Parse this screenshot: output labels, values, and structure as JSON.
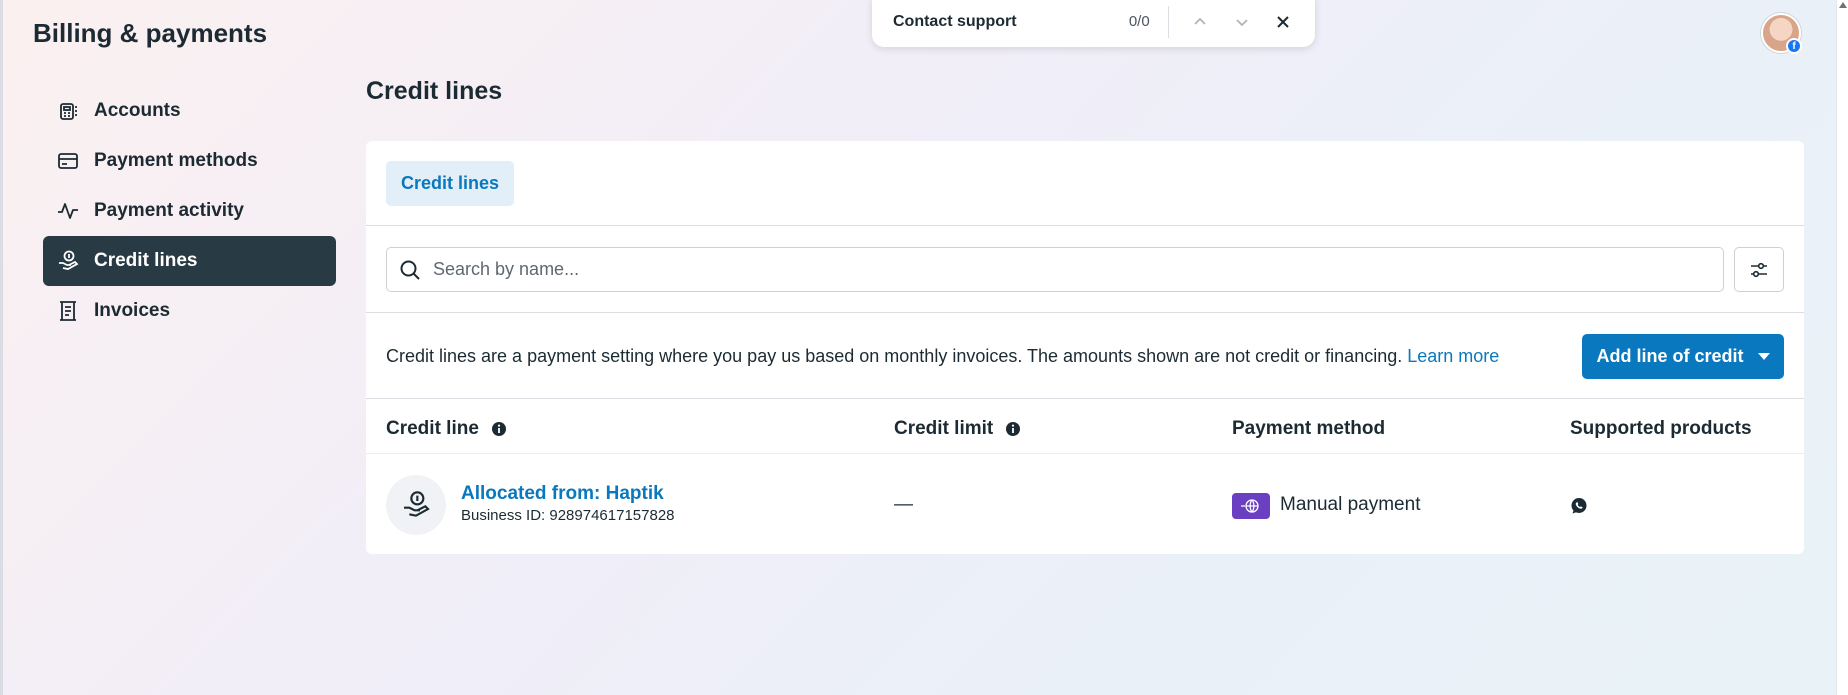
{
  "app": {
    "title": "Billing & payments"
  },
  "sidebar": {
    "items": [
      {
        "label": "Accounts",
        "icon": "accounts-icon",
        "active": false
      },
      {
        "label": "Payment methods",
        "icon": "card-icon",
        "active": false
      },
      {
        "label": "Payment activity",
        "icon": "activity-icon",
        "active": false
      },
      {
        "label": "Credit lines",
        "icon": "credit-line-icon",
        "active": true
      },
      {
        "label": "Invoices",
        "icon": "invoice-icon",
        "active": false
      }
    ]
  },
  "support_popup": {
    "label": "Contact support",
    "count": "0/0"
  },
  "page": {
    "title": "Credit lines",
    "tab": "Credit lines",
    "search_placeholder": "Search by name...",
    "info_text": "Credit lines are a payment setting where you pay us based on monthly invoices. The amounts shown are not credit or financing.",
    "learn_more": "Learn more",
    "add_button": "Add line of credit"
  },
  "table": {
    "headers": {
      "credit_line": "Credit line",
      "credit_limit": "Credit limit",
      "payment_method": "Payment method",
      "supported_products": "Supported products"
    },
    "rows": [
      {
        "name": "Allocated from: Haptik",
        "business_id": "Business ID: 928974617157828",
        "credit_limit": "—",
        "payment_method": "Manual payment",
        "supported_product_icon": "whatsapp-icon"
      }
    ]
  },
  "colors": {
    "accent": "#0a78be",
    "active_nav": "#283a44",
    "payment_badge": "#6b3fc1"
  }
}
